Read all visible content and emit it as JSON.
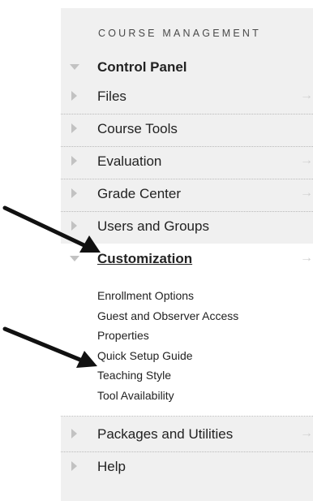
{
  "panel": {
    "section_title": "COURSE MANAGEMENT",
    "items": [
      {
        "label": "Control Panel",
        "expanded": true,
        "bold": true,
        "arrow": false
      },
      {
        "label": "Files",
        "arrow": true
      },
      {
        "label": "Course Tools",
        "arrow": false
      },
      {
        "label": "Evaluation",
        "arrow": true
      },
      {
        "label": "Grade Center",
        "arrow": true
      },
      {
        "label": "Users and Groups",
        "arrow": false
      },
      {
        "label": "Customization",
        "expanded": true,
        "bold": true,
        "underline": true,
        "arrow": true
      },
      {
        "label": "Packages and Utilities",
        "arrow": true
      },
      {
        "label": "Help",
        "arrow": false
      }
    ],
    "customization_subitems": [
      "Enrollment Options",
      "Guest and Observer Access",
      "Properties",
      "Quick Setup Guide",
      "Teaching Style",
      "Tool Availability"
    ],
    "arrow_glyph": "→"
  }
}
